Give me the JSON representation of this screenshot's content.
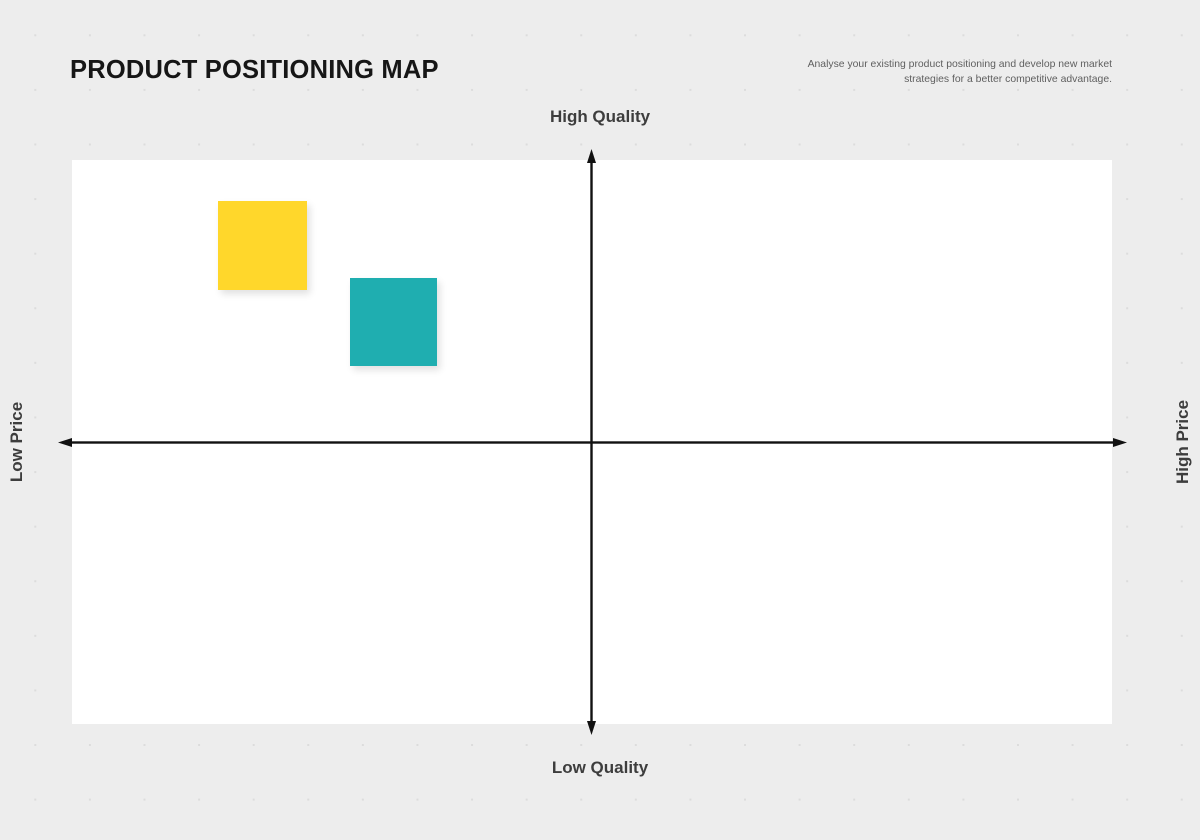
{
  "header": {
    "title": "PRODUCT POSITIONING MAP",
    "subtitle": "Analyse your existing product positioning and develop new market strategies for a better competitive advantage."
  },
  "chart_data": {
    "type": "scatter",
    "title": "PRODUCT POSITIONING MAP",
    "subtitle": "Analyse your existing product positioning and develop new market strategies for a better competitive advantage.",
    "xlabel": "",
    "ylabel": "",
    "axis_labels": {
      "top": "High Quality",
      "bottom": "Low Quality",
      "left": "Low Price",
      "right": "High Price"
    },
    "x_axis": {
      "negative_end": "Low Price",
      "positive_end": "High Price"
    },
    "y_axis": {
      "negative_end": "Low Quality",
      "positive_end": "High Quality"
    },
    "quadrants": [
      "Low Price / High Quality",
      "High Price / High Quality",
      "Low Price / Low Quality",
      "High Price / Low Quality"
    ],
    "grid": false,
    "legend": "none",
    "markers": [
      {
        "label": "",
        "shape": "square",
        "color": "#ffd72b",
        "quadrant": "Low Price / High Quality",
        "x": -0.71,
        "y": 0.64,
        "size": 89
      },
      {
        "label": "",
        "shape": "square",
        "color": "#1faeb0",
        "quadrant": "Low Price / High Quality",
        "x": -0.45,
        "y": 0.36,
        "size": 87
      }
    ],
    "colors": {
      "background": "#ededed",
      "panel": "#ffffff",
      "axis": "#111111",
      "dots": "#dcdcdc",
      "title": "#161616",
      "label": "#3d3d3d",
      "subtitle": "#5f5f5f"
    }
  }
}
